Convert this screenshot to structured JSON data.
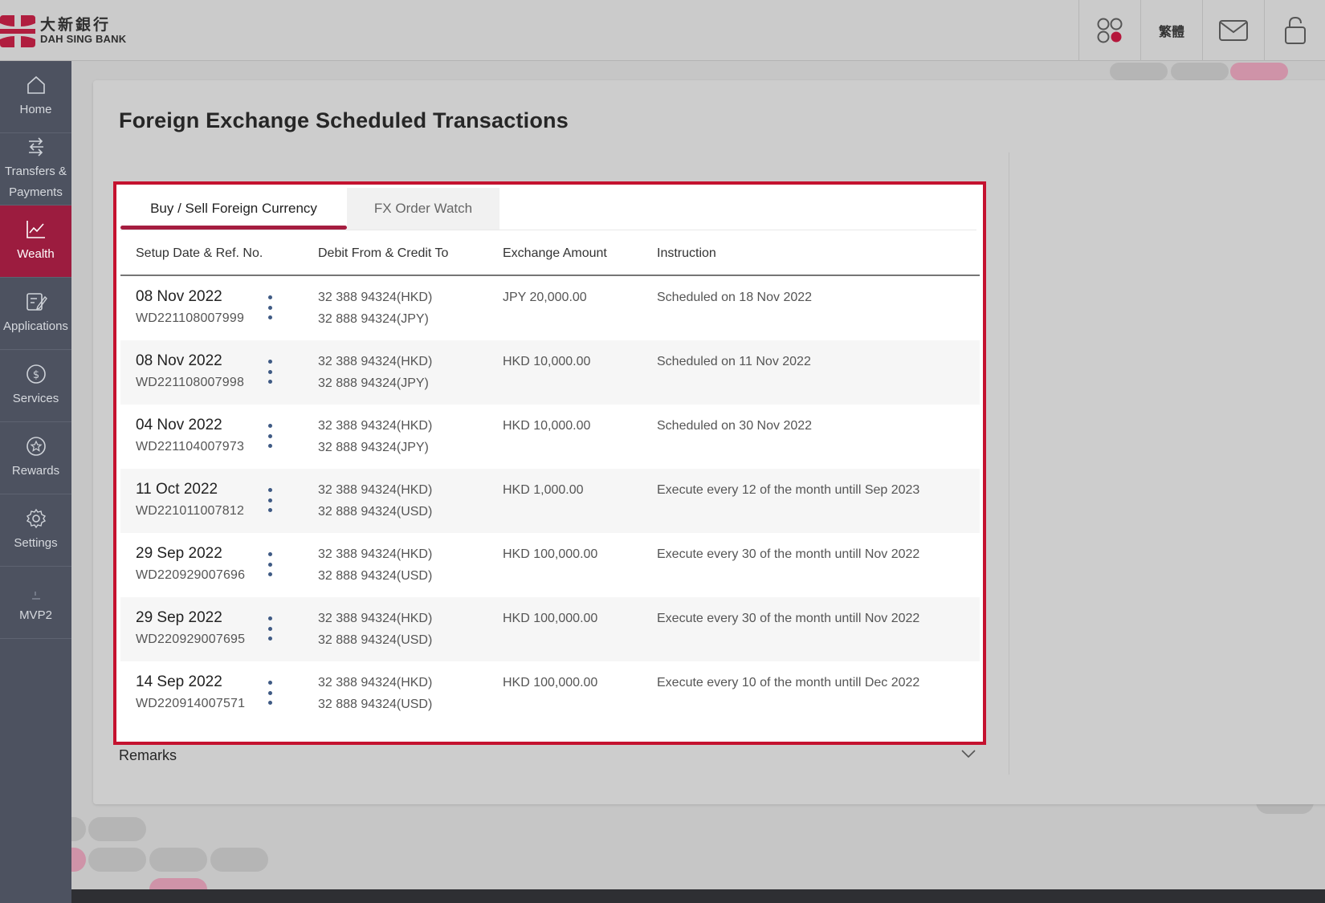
{
  "brand": {
    "name_cn": "大新銀行",
    "name_en": "DAH SING BANK",
    "primary": "#9c1c3f",
    "accent_border": "#c4122f"
  },
  "header": {
    "apps_icon": "apps-grid-icon",
    "language_label": "繁體",
    "mail_icon": "mail-icon",
    "logout_icon": "lock-icon"
  },
  "sidebar": {
    "items": [
      {
        "label": "Home",
        "icon": "home-icon"
      },
      {
        "label_line1": "Transfers &",
        "label_line2": "Payments",
        "icon": "transfer-icon"
      },
      {
        "label": "Wealth",
        "icon": "chart-icon",
        "active": true
      },
      {
        "label": "Applications",
        "icon": "edit-icon"
      },
      {
        "label": "Services",
        "icon": "dollar-icon"
      },
      {
        "label": "Rewards",
        "icon": "star-icon"
      },
      {
        "label": "Settings",
        "icon": "gear-icon"
      },
      {
        "label": "MVP2",
        "icon": "mvp-icon"
      }
    ]
  },
  "page": {
    "title": "Foreign Exchange Scheduled Transactions",
    "tabs": [
      {
        "label": "Buy / Sell Foreign Currency",
        "active": true
      },
      {
        "label": "FX Order Watch",
        "active": false
      }
    ],
    "columns": {
      "setup": "Setup Date & Ref. No.",
      "accounts": "Debit From & Credit To",
      "amount": "Exchange Amount",
      "instruction": "Instruction"
    },
    "rows": [
      {
        "date": "08 Nov 2022",
        "ref": "WD221108007999",
        "debit": "32 388 94324(HKD)",
        "credit": "32 888 94324(JPY)",
        "amount": "JPY 20,000.00",
        "instruction": "Scheduled on 18 Nov 2022"
      },
      {
        "date": "08 Nov 2022",
        "ref": "WD221108007998",
        "debit": "32 388 94324(HKD)",
        "credit": "32 888 94324(JPY)",
        "amount": "HKD 10,000.00",
        "instruction": "Scheduled on 11 Nov 2022"
      },
      {
        "date": "04 Nov 2022",
        "ref": "WD221104007973",
        "debit": "32 388 94324(HKD)",
        "credit": "32 888 94324(JPY)",
        "amount": "HKD 10,000.00",
        "instruction": "Scheduled on 30 Nov 2022"
      },
      {
        "date": "11 Oct 2022",
        "ref": "WD221011007812",
        "debit": "32 388 94324(HKD)",
        "credit": "32 888 94324(USD)",
        "amount": "HKD 1,000.00",
        "instruction": "Execute every 12 of the month untill Sep 2023"
      },
      {
        "date": "29 Sep 2022",
        "ref": "WD220929007696",
        "debit": "32 388 94324(HKD)",
        "credit": "32 888 94324(USD)",
        "amount": "HKD 100,000.00",
        "instruction": "Execute every 30 of the month untill Nov 2022"
      },
      {
        "date": "29 Sep 2022",
        "ref": "WD220929007695",
        "debit": "32 388 94324(HKD)",
        "credit": "32 888 94324(USD)",
        "amount": "HKD 100,000.00",
        "instruction": "Execute every 30 of the month untill Nov 2022"
      },
      {
        "date": "14 Sep 2022",
        "ref": "WD220914007571",
        "debit": "32 388 94324(HKD)",
        "credit": "32 888 94324(USD)",
        "amount": "HKD 100,000.00",
        "instruction": "Execute every 10 of the month untill Dec 2022"
      }
    ],
    "remarks_label": "Remarks"
  }
}
